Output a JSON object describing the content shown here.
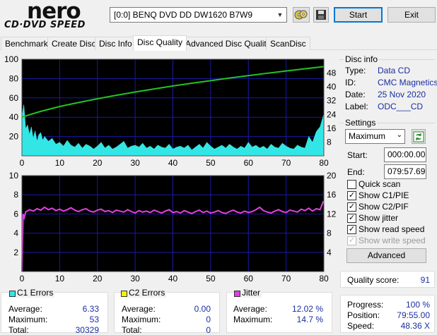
{
  "app": {
    "logo_main": "nero",
    "logo_sub": "CD·DVD SPEED",
    "drive": "[0:0]  BENQ DVD DD DW1620 B7W9",
    "start_label": "Start",
    "exit_label": "Exit"
  },
  "tabs": [
    {
      "label": "Benchmark"
    },
    {
      "label": "Create Disc"
    },
    {
      "label": "Disc Info"
    },
    {
      "label": "Disc Quality"
    },
    {
      "label": "Advanced Disc Quality"
    },
    {
      "label": "ScanDisc"
    }
  ],
  "active_tab": 3,
  "disc_info": {
    "title": "Disc info",
    "type_label": "Type:",
    "type_value": "Data CD",
    "id_label": "ID:",
    "id_value": "CMC Magnetics",
    "date_label": "Date:",
    "date_value": "25 Nov 2020",
    "label_label": "Label:",
    "label_value": "ODC___CD"
  },
  "settings": {
    "title": "Settings",
    "speed": "Maximum",
    "start_label": "Start:",
    "start_value": "000:00.00",
    "end_label": "End:",
    "end_value": "079:57.69",
    "options": [
      {
        "label": "Quick scan",
        "checked": false,
        "disabled": false
      },
      {
        "label": "Show C1/PIE",
        "checked": true,
        "disabled": false
      },
      {
        "label": "Show C2/PIF",
        "checked": true,
        "disabled": false
      },
      {
        "label": "Show jitter",
        "checked": true,
        "disabled": false
      },
      {
        "label": "Show read speed",
        "checked": true,
        "disabled": false
      },
      {
        "label": "Show write speed",
        "checked": true,
        "disabled": true
      }
    ],
    "advanced_label": "Advanced"
  },
  "quality": {
    "label": "Quality score:",
    "value": "91"
  },
  "progress": {
    "progress_label": "Progress:",
    "progress_value": "100 %",
    "position_label": "Position:",
    "position_value": "79:55.00",
    "speed_label": "Speed:",
    "speed_value": "48.36 X"
  },
  "c1": {
    "title": "C1 Errors",
    "avg_label": "Average:",
    "avg": "6.33",
    "max_label": "Maximum:",
    "max": "53",
    "total_label": "Total:",
    "total": "30329"
  },
  "c2": {
    "title": "C2 Errors",
    "avg_label": "Average:",
    "avg": "0.00",
    "max_label": "Maximum:",
    "max": "0",
    "total_label": "Total:",
    "total": "0"
  },
  "jitter": {
    "title": "Jitter",
    "avg_label": "Average:",
    "avg": "12.02 %",
    "max_label": "Maximum:",
    "max": "14.7 %"
  },
  "colors": {
    "plot_bg": "#000000",
    "grid": "#1a1aa8",
    "c1": "#33e6e6",
    "speed": "#22c422",
    "jitter": "#e040e0",
    "c2_swatch": "#f4f400"
  },
  "chart_data": [
    {
      "type": "area",
      "x_ticks": [
        "0",
        "10",
        "20",
        "30",
        "40",
        "50",
        "60",
        "70",
        "80"
      ],
      "y_left_ticks": [
        "100",
        "80",
        "60",
        "40",
        "20"
      ],
      "y_right_ticks": [
        "48",
        "40",
        "32",
        "24",
        "16",
        "8"
      ],
      "xlim": [
        0,
        80
      ],
      "ylim_left": [
        0,
        100
      ],
      "ylim_right": [
        0,
        56
      ],
      "series": [
        {
          "name": "C1 Errors",
          "axis": "left",
          "x": [
            0,
            0.5,
            1,
            1.5,
            2,
            2.5,
            3,
            3.5,
            4,
            4.5,
            5,
            5.5,
            6,
            7,
            8,
            9,
            10,
            11,
            12,
            13,
            14,
            15,
            16,
            17,
            18,
            19,
            20,
            21,
            22,
            23,
            24,
            25,
            26,
            27,
            28,
            29,
            30,
            31,
            32,
            33,
            34,
            35,
            36,
            37,
            38,
            39,
            40,
            41,
            42,
            43,
            44,
            45,
            46,
            47,
            48,
            49,
            50,
            51,
            52,
            53,
            54,
            55,
            56,
            57,
            58,
            59,
            60,
            61,
            62,
            63,
            64,
            65,
            66,
            67,
            68,
            69,
            70,
            71,
            72,
            73,
            74,
            75,
            76,
            77,
            78,
            79,
            79.9
          ],
          "y": [
            40,
            53,
            28,
            32,
            22,
            30,
            18,
            26,
            15,
            22,
            24,
            16,
            20,
            15,
            18,
            12,
            14,
            10,
            16,
            11,
            9,
            13,
            8,
            12,
            10,
            7,
            10,
            14,
            8,
            11,
            7,
            9,
            12,
            15,
            8,
            10,
            11,
            9,
            13,
            8,
            10,
            7,
            11,
            9,
            8,
            12,
            7,
            9,
            10,
            8,
            11,
            6,
            9,
            12,
            8,
            14,
            10,
            7,
            9,
            11,
            8,
            12,
            9,
            7,
            10,
            8,
            14,
            9,
            11,
            8,
            10,
            7,
            12,
            9,
            8,
            13,
            10,
            8,
            7,
            11,
            9,
            8,
            20,
            14,
            25,
            30,
            42
          ]
        },
        {
          "name": "Read Speed",
          "axis": "right",
          "x": [
            0,
            5,
            10,
            15,
            20,
            25,
            30,
            35,
            40,
            45,
            50,
            55,
            60,
            65,
            70,
            75,
            79.9
          ],
          "y": [
            22.5,
            25.8,
            28.6,
            30.9,
            33.1,
            35.1,
            37.0,
            38.8,
            40.5,
            42.1,
            43.6,
            45.1,
            46.5,
            47.9,
            49.2,
            50.5,
            51.7
          ]
        }
      ]
    },
    {
      "type": "line",
      "x_ticks": [
        "0",
        "10",
        "20",
        "30",
        "40",
        "50",
        "60",
        "70",
        "80"
      ],
      "y_left_ticks": [
        "10",
        "8",
        "6",
        "4",
        "2"
      ],
      "y_right_ticks": [
        "20",
        "16",
        "12",
        "8",
        "4"
      ],
      "xlim": [
        0,
        80
      ],
      "ylim_left": [
        0,
        10
      ],
      "ylim_right": [
        0,
        20
      ],
      "series": [
        {
          "name": "Jitter",
          "axis": "right",
          "x": [
            0,
            0.3,
            0.6,
            1,
            2,
            3,
            4,
            5,
            6,
            7,
            8,
            9,
            10,
            11,
            12,
            13,
            14,
            15,
            16,
            17,
            18,
            19,
            20,
            21,
            22,
            23,
            24,
            25,
            26,
            27,
            28,
            29,
            30,
            31,
            32,
            33,
            34,
            35,
            36,
            37,
            38,
            39,
            40,
            41,
            42,
            43,
            44,
            45,
            46,
            47,
            48,
            49,
            50,
            51,
            52,
            53,
            54,
            55,
            56,
            57,
            58,
            59,
            60,
            61,
            62,
            63,
            64,
            65,
            66,
            67,
            68,
            69,
            70,
            71,
            72,
            73,
            74,
            75,
            76,
            77,
            78,
            79,
            79.9
          ],
          "y": [
            0,
            12,
            11.2,
            12.4,
            12.9,
            12.6,
            13.1,
            12.8,
            13.4,
            12.9,
            13.2,
            12.7,
            13.0,
            12.6,
            12.9,
            13.3,
            12.8,
            12.5,
            12.9,
            13.1,
            12.6,
            12.4,
            12.8,
            13.0,
            12.5,
            12.7,
            12.3,
            12.8,
            12.6,
            12.4,
            12.9,
            12.5,
            12.2,
            12.7,
            12.4,
            12.6,
            12.3,
            12.8,
            12.5,
            12.2,
            12.6,
            12.9,
            12.3,
            12.5,
            12.2,
            12.7,
            12.4,
            12.1,
            12.5,
            12.8,
            12.3,
            12.6,
            12.2,
            12.4,
            12.7,
            12.3,
            12.1,
            12.5,
            12.8,
            12.4,
            12.2,
            12.6,
            12.3,
            12.5,
            12.9,
            13.4,
            12.7,
            12.4,
            12.2,
            12.6,
            12.9,
            12.5,
            12.3,
            12.8,
            12.6,
            12.4,
            13.0,
            12.7,
            13.2,
            12.6,
            13.1,
            12.9,
            14.7
          ]
        }
      ]
    }
  ]
}
